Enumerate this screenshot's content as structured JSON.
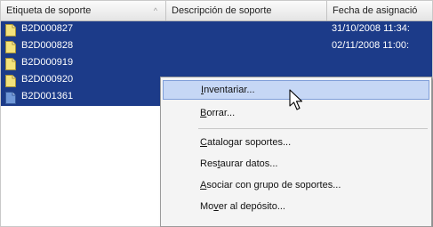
{
  "columns": [
    {
      "label": "Etiqueta de soporte",
      "sort_indicator": "^"
    },
    {
      "label": "Descripción de soporte"
    },
    {
      "label": "Fecha de asignació"
    }
  ],
  "rows": [
    {
      "label": "B2D000827",
      "description": "",
      "date": "31/10/2008 11:34:",
      "selected": true,
      "icon": "file-yellow-icon"
    },
    {
      "label": "B2D000828",
      "description": "",
      "date": "02/11/2008 11:00:",
      "selected": true,
      "icon": "file-yellow-icon"
    },
    {
      "label": "B2D000919",
      "description": "",
      "date": "",
      "selected": true,
      "icon": "file-yellow-icon"
    },
    {
      "label": "B2D000920",
      "description": "",
      "date": "",
      "selected": true,
      "icon": "file-yellow-icon"
    },
    {
      "label": "B2D001361",
      "description": "",
      "date": "",
      "selected": true,
      "icon": "file-blue-icon"
    }
  ],
  "context_menu": {
    "items": [
      {
        "pre": "",
        "accel": "I",
        "post": "nventariar...",
        "highlighted": true
      },
      {
        "pre": "",
        "accel": "B",
        "post": "orrar...",
        "highlighted": false
      },
      {
        "pre": "",
        "accel": "C",
        "post": "atalogar soportes...",
        "highlighted": false
      },
      {
        "pre": "Res",
        "accel": "t",
        "post": "aurar datos...",
        "highlighted": false
      },
      {
        "pre": "",
        "accel": "A",
        "post": "sociar con grupo de soportes...",
        "highlighted": false
      },
      {
        "pre": "Mo",
        "accel": "v",
        "post": "er al depósito...",
        "highlighted": false
      }
    ]
  },
  "colors": {
    "selection": "#1c3b89",
    "menu_highlight": "#c6d7f5",
    "menu_highlight_border": "#7f9ed9",
    "icon_yellow": "#f3e27b",
    "icon_blue": "#6f97d8"
  }
}
